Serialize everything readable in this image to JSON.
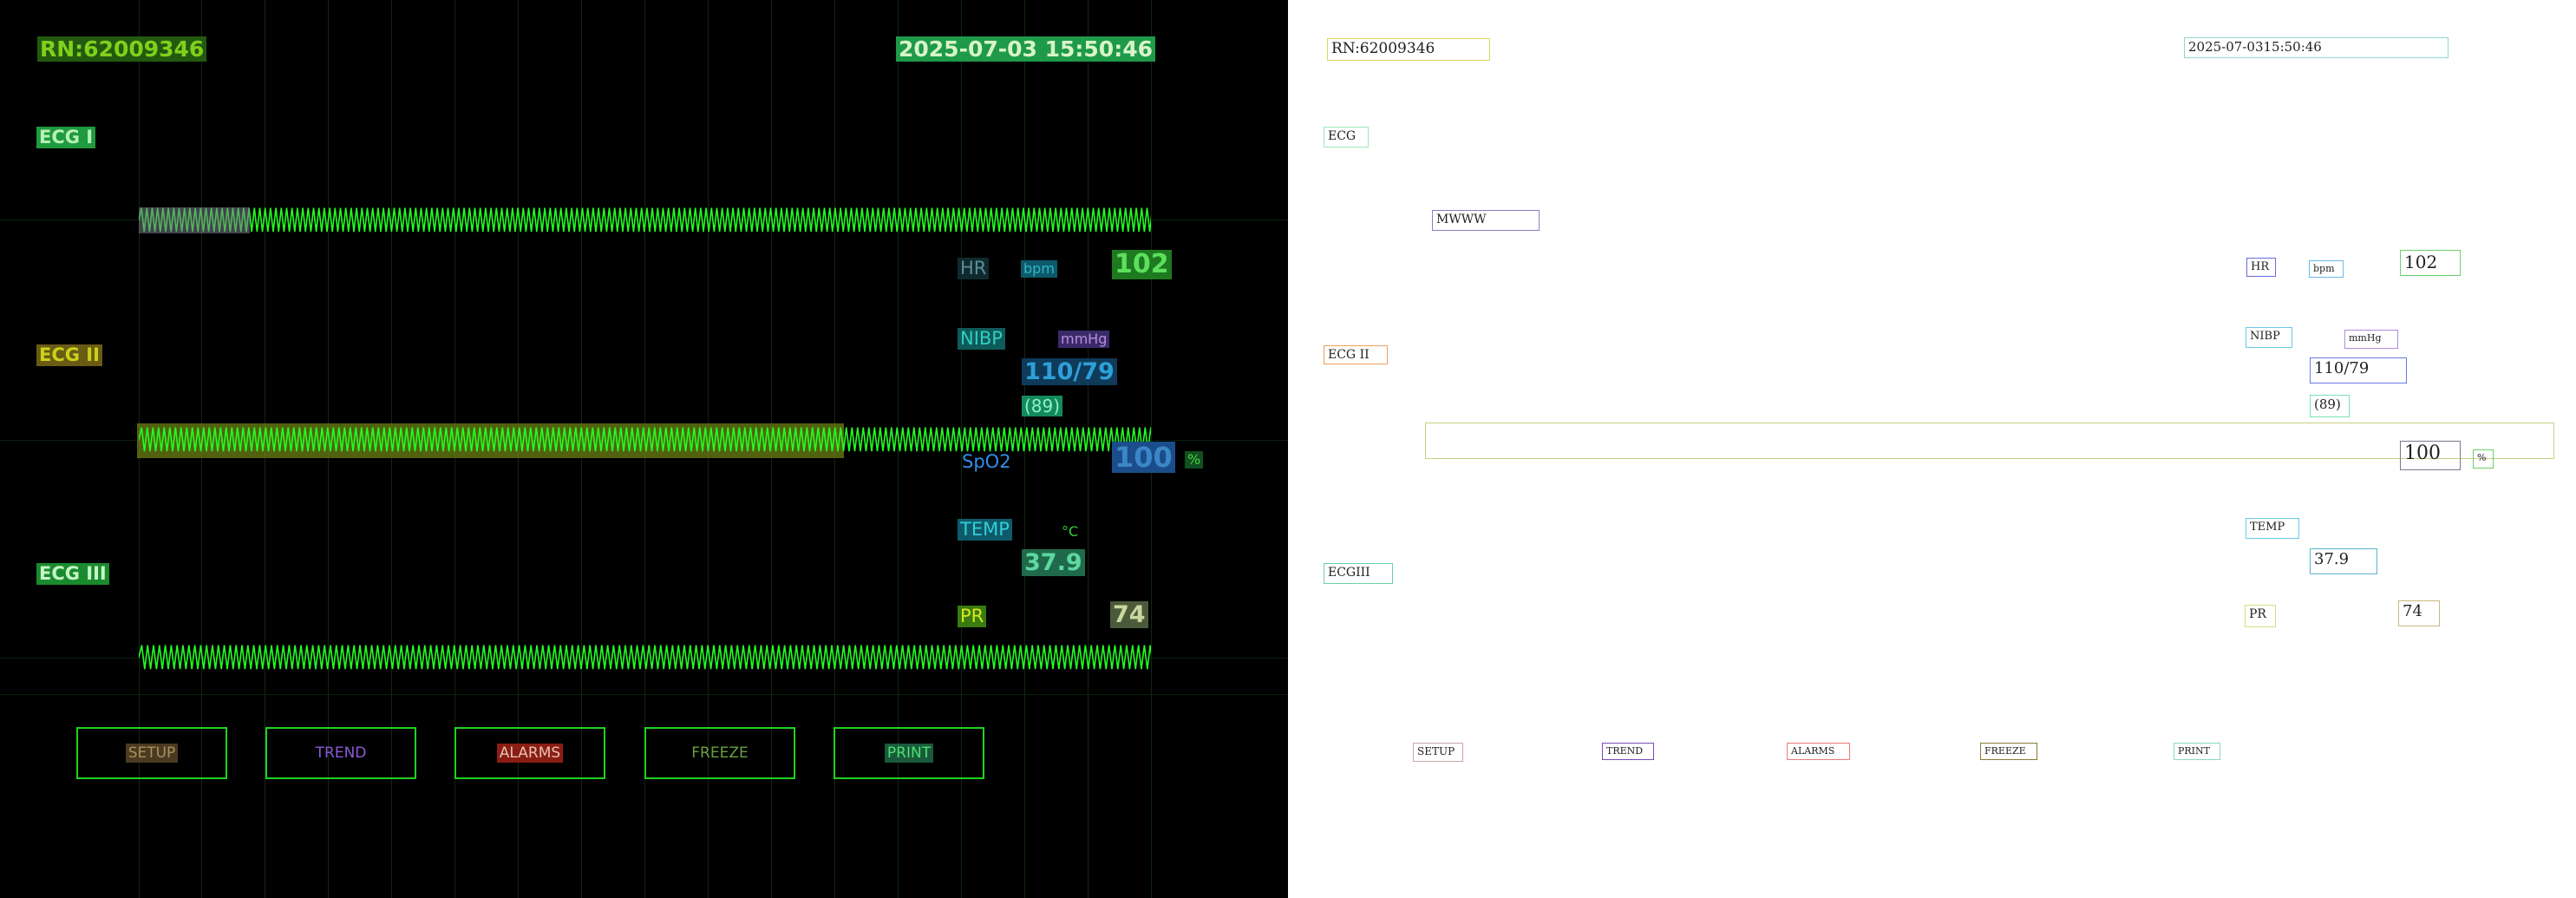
{
  "header": {
    "record_number": "RN:62009346",
    "datetime": "2025-07-03 15:50:46"
  },
  "leads": {
    "lead1": "ECG I",
    "lead2": "ECG II",
    "lead3": "ECG III"
  },
  "vitals": {
    "hr": {
      "label": "HR",
      "unit": "bpm",
      "value": "102"
    },
    "nibp": {
      "label": "NIBP",
      "unit": "mmHg",
      "value": "110/79",
      "mean": "(89)"
    },
    "spo2": {
      "label": "SpO2",
      "value": "100",
      "unit": "%"
    },
    "temp": {
      "label": "TEMP",
      "unit": "°C",
      "value": "37.9"
    },
    "pr": {
      "label": "PR",
      "value": "74"
    }
  },
  "buttons": {
    "setup": "SETUP",
    "trend": "TREND",
    "alarms": "ALARMS",
    "freeze": "FREEZE",
    "print": "PRINT"
  },
  "annotations": {
    "record_number": "RN:62009346",
    "datetime": "2025-07-0315:50:46",
    "lead1": "ECG",
    "wave_fragment": "MWWW",
    "lead2": "ECG II",
    "lead3": "ECGIII",
    "hr_label": "HR",
    "hr_unit": "bpm",
    "hr_value": "102",
    "nibp_label": "NIBP",
    "nibp_unit": "mmHg",
    "nibp_value": "110/79",
    "nibp_mean": "(89)",
    "spo2_value": "100",
    "spo2_unit": "%",
    "temp_label": "TEMP",
    "temp_value": "37.9",
    "pr_label": "PR",
    "pr_value": "74",
    "setup": "SETUP",
    "trend": "TREND",
    "alarms": "ALARMS",
    "freeze": "FREEZE",
    "print": "PRINT"
  },
  "colors": {
    "monitor_bg": "#000000",
    "waveform": "#22ff22",
    "grid": "#0d2a0d"
  }
}
